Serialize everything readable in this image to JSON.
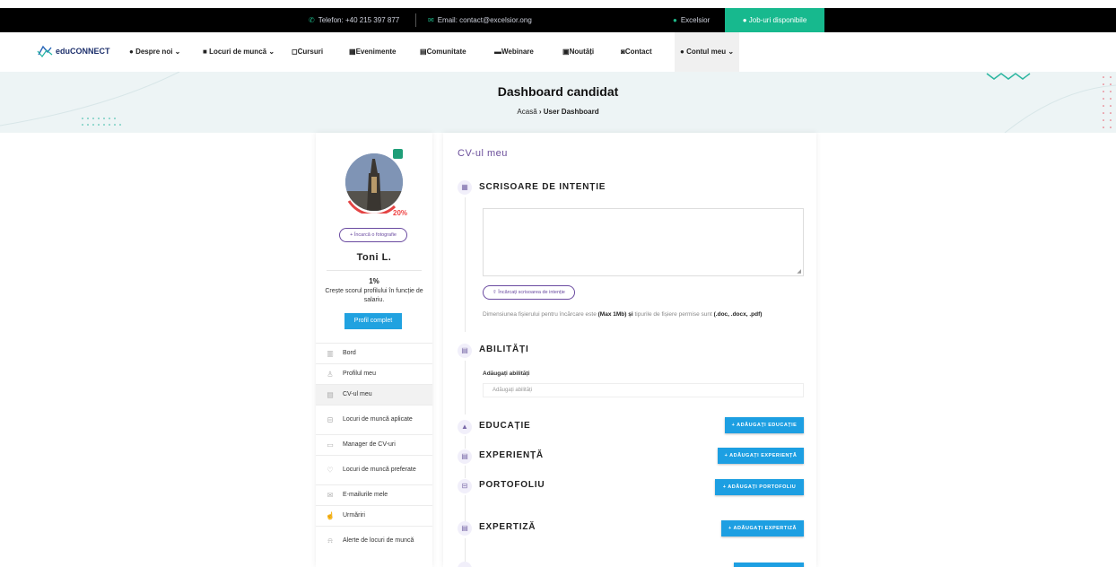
{
  "topbar": {
    "phone": "Telefon: +40 215 397 877",
    "email": "Email: contact@excelsior.ong",
    "org": "Excelsior",
    "jobs": "Job-uri disponibile"
  },
  "nav": {
    "logo": "eduCONNECT",
    "items": [
      "Despre noi",
      "Locuri de muncă",
      "Cursuri",
      "Evenimente",
      "Comunitate",
      "Webinare",
      "Noutăți",
      "Contact",
      "Contul meu"
    ]
  },
  "hero": {
    "title": "Dashboard candidat",
    "crumb_home": "Acasă",
    "crumb_sep": "›",
    "crumb_current": "User Dashboard"
  },
  "sidebar": {
    "completion": "20%",
    "upload_photo": "Încarcă o fotografie",
    "name": "Toni L.",
    "score_pct": "1%",
    "score_text": "Crește scorul profilului în funcție de salariu.",
    "profile_button": "Profil complet",
    "menu": [
      {
        "label": "Bord",
        "icon": "dashboard-icon"
      },
      {
        "label": "Profilul meu",
        "icon": "user-icon"
      },
      {
        "label": "CV-ul meu",
        "icon": "document-icon"
      },
      {
        "label": "Locuri de muncă aplicate",
        "icon": "briefcase-icon"
      },
      {
        "label": "Manager de CV-uri",
        "icon": "cv-manager-icon"
      },
      {
        "label": "Locuri de muncă preferate",
        "icon": "heart-icon"
      },
      {
        "label": "E-mailurile mele",
        "icon": "mail-icon"
      },
      {
        "label": "Urmăriri",
        "icon": "thumbs-up-icon"
      },
      {
        "label": "Alerte de locuri de muncă",
        "icon": "bell-icon"
      }
    ]
  },
  "main": {
    "title": "CV-ul meu",
    "cover": {
      "title": "SCRISOARE DE INTENȚIE",
      "upload": "Încărcați scrisoarea de intenție",
      "note_prefix": "Dimensiunea fișierului pentru încărcare este",
      "note_max": "(Max 1Mb)",
      "note_and": "și",
      "note_mid": "tipurile de fișiere permise sunt",
      "note_types": "(.doc, .docx, .pdf)"
    },
    "skills": {
      "title": "ABILITĂȚI",
      "label": "Adăugați abilități",
      "placeholder": "Adăugați abilități"
    },
    "education": {
      "title": "EDUCAȚIE",
      "button": "+ ADĂUGAȚI EDUCAȚIE"
    },
    "experience": {
      "title": "EXPERIENȚĂ",
      "button": "+ ADĂUGAȚI EXPERIENȚĂ"
    },
    "portfolio": {
      "title": "PORTOFOLIU",
      "button": "+ ADĂUGAȚI PORTOFOLIU"
    },
    "expertise": {
      "title": "EXPERTIZĂ",
      "button": "+ ADĂUGAȚI EXPERTIZĂ"
    }
  },
  "colors": {
    "accent_green": "#17b98e",
    "accent_blue": "#1d9fe2",
    "accent_purple": "#6a4aa0",
    "progress_red": "#e44444"
  }
}
